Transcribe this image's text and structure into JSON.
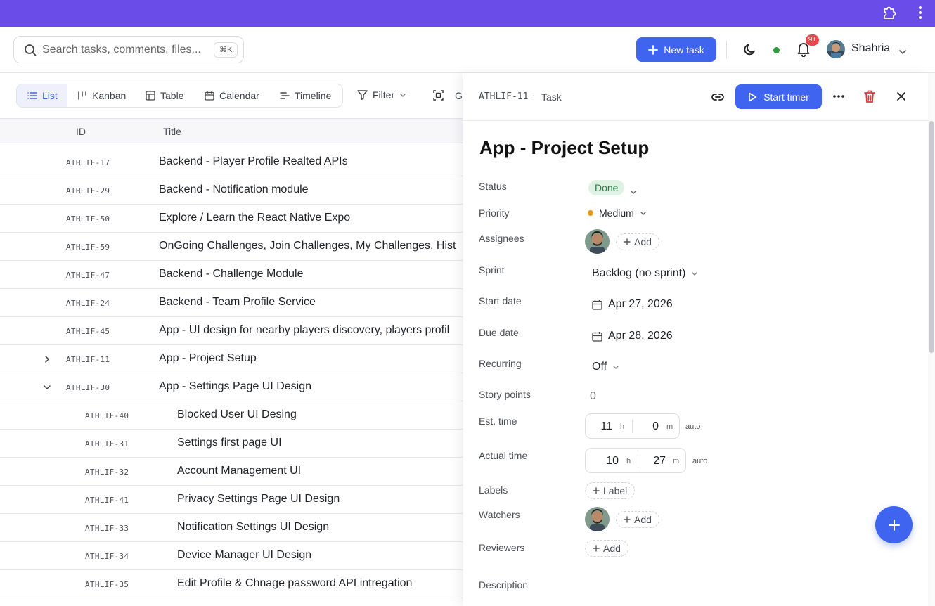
{
  "topbar": {
    "extension_icon": "puzzle-icon",
    "menu_icon": "kebab-vertical-icon",
    "color": "#6a4de8"
  },
  "search": {
    "placeholder": "Search tasks, comments, files...",
    "shortcut": "⌘K"
  },
  "header": {
    "new_task_label": "New task",
    "notifications_badge": "9+",
    "user_name": "Shahria",
    "accent": "#3f64f0"
  },
  "views": {
    "tabs": [
      {
        "label": "List",
        "active": true
      },
      {
        "label": "Kanban",
        "active": false
      },
      {
        "label": "Table",
        "active": false
      },
      {
        "label": "Calendar",
        "active": false
      },
      {
        "label": "Timeline",
        "active": false
      }
    ],
    "filter_label": "Filter",
    "group_label_partial": "G"
  },
  "table": {
    "columns": [
      "ID",
      "Title"
    ],
    "rows": [
      {
        "id": "ATHLIF-17",
        "title": "Backend - Player Profile Realted APIs",
        "level": 0
      },
      {
        "id": "ATHLIF-29",
        "title": "Backend - Notification module",
        "level": 0
      },
      {
        "id": "ATHLIF-50",
        "title": "Explore / Learn the React Native Expo",
        "level": 0
      },
      {
        "id": "ATHLIF-59",
        "title": "OnGoing Challenges, Join Challenges, My Challenges, Hist",
        "level": 0
      },
      {
        "id": "ATHLIF-47",
        "title": "Backend - Challenge Module",
        "level": 0
      },
      {
        "id": "ATHLIF-24",
        "title": "Backend - Team Profile Service",
        "level": 0
      },
      {
        "id": "ATHLIF-45",
        "title": "App - UI design for nearby players discovery, players profil",
        "level": 0
      },
      {
        "id": "ATHLIF-11",
        "title": "App - Project Setup",
        "level": 0,
        "toggle": "collapsed"
      },
      {
        "id": "ATHLIF-30",
        "title": "App - Settings Page UI Design",
        "level": 0,
        "toggle": "expanded"
      },
      {
        "id": "ATHLIF-40",
        "title": "Blocked User UI Desing",
        "level": 1
      },
      {
        "id": "ATHLIF-31",
        "title": "Settings first page UI",
        "level": 1
      },
      {
        "id": "ATHLIF-32",
        "title": "Account Management UI",
        "level": 1
      },
      {
        "id": "ATHLIF-41",
        "title": "Privacy Settings Page UI Design",
        "level": 1
      },
      {
        "id": "ATHLIF-33",
        "title": "Notification Settings UI Design",
        "level": 1
      },
      {
        "id": "ATHLIF-34",
        "title": "Device Manager UI Design",
        "level": 1
      },
      {
        "id": "ATHLIF-35",
        "title": "Edit Profile & Chnage password API intregation",
        "level": 1
      }
    ]
  },
  "detail": {
    "key": "ATHLIF-11",
    "separator": "·",
    "type": "Task",
    "start_timer_label": "Start timer",
    "title": "App - Project Setup",
    "labels": {
      "status": "Status",
      "priority": "Priority",
      "assignees": "Assignees",
      "sprint": "Sprint",
      "start_date": "Start date",
      "due_date": "Due date",
      "recurring": "Recurring",
      "story_points": "Story points",
      "est_time": "Est. time",
      "actual_time": "Actual time",
      "labels": "Labels",
      "watchers": "Watchers",
      "reviewers": "Reviewers",
      "description": "Description"
    },
    "status": "Done",
    "priority": "Medium",
    "add_label": "Add",
    "sprint": "Backlog (no sprint)",
    "start_date": "Apr 27, 2026",
    "due_date": "Apr 28, 2026",
    "recurring": "Off",
    "story_points": "0",
    "est_time": {
      "hours": "11",
      "minutes": "0",
      "h_unit": "h",
      "m_unit": "m",
      "auto": "auto"
    },
    "actual_time": {
      "hours": "10",
      "minutes": "27",
      "h_unit": "h",
      "m_unit": "m",
      "auto": "auto"
    },
    "label_button": "Label"
  }
}
